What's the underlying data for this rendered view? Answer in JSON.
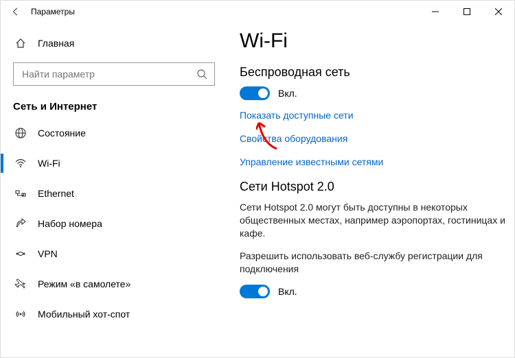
{
  "titlebar": {
    "title": "Параметры"
  },
  "sidebar": {
    "home": "Главная",
    "search_placeholder": "Найти параметр",
    "section": "Сеть и Интернет",
    "items": [
      {
        "label": "Состояние"
      },
      {
        "label": "Wi-Fi"
      },
      {
        "label": "Ethernet"
      },
      {
        "label": "Набор номера"
      },
      {
        "label": "VPN"
      },
      {
        "label": "Режим «в самолете»"
      },
      {
        "label": "Мобильный хот-спот"
      }
    ]
  },
  "content": {
    "heading": "Wi-Fi",
    "wireless_title": "Беспроводная сеть",
    "toggle1_label": "Вкл.",
    "link_available": "Показать доступные сети",
    "link_hw": "Свойства оборудования",
    "link_known": "Управление известными сетями",
    "hotspot_title": "Сети Hotspot 2.0",
    "hotspot_desc": "Сети Hotspot 2.0 могут быть доступны в некоторых общественных местах, например аэропортах, гостиницах и кафе.",
    "hotspot_allow": "Разрешить использовать веб-службу регистрации для подключения",
    "toggle2_label": "Вкл."
  }
}
